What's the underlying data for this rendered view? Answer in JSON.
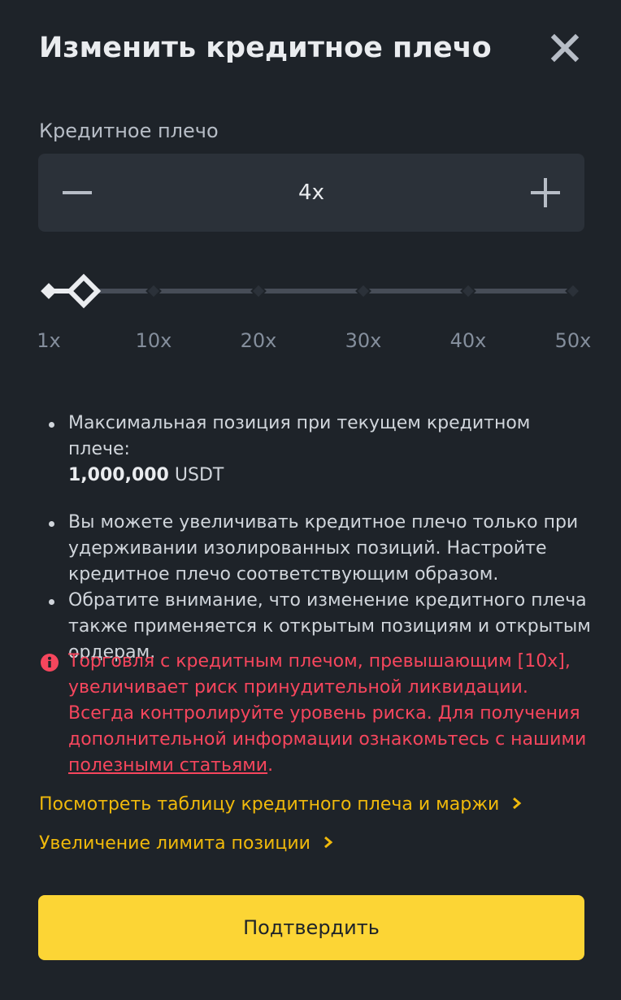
{
  "modal": {
    "title": "Изменить кредитное плечо",
    "close_icon": "close-icon"
  },
  "leverage": {
    "label": "Кредитное плечо",
    "value": "4x",
    "numeric_value": 4,
    "min": 1,
    "max": 50,
    "minus_icon": "minus-icon",
    "plus_icon": "plus-icon"
  },
  "slider": {
    "ticks": [
      "1x",
      "10x",
      "20x",
      "30x",
      "40x",
      "50x"
    ],
    "tick_values": [
      1,
      10,
      20,
      30,
      40,
      50
    ]
  },
  "info": {
    "max_position_text": "Максимальная позиция при текущем кредитном плече:",
    "max_position_value": "1,000,000",
    "max_position_unit": "USDT",
    "isolated_note": "Вы можете увеличивать кредитное плечо только при удерживании изолированных позиций. Настройте кредитное плечо соответствующим образом.",
    "open_orders_note": "Обратите внимание, что изменение кредитного плеча также применяется к открытым позициям и открытым ордерам."
  },
  "warning": {
    "icon": "info-circle-icon",
    "text": "Торговля с кредитным плечом, превышающим [10x], увеличивает риск принудительной ликвидации. Всегда контролируйте уровень риска. Для получения дополнительной информации ознакомьтесь с нашими ",
    "link_text": "полезными статьями",
    "end": "."
  },
  "links": {
    "margin_table": "Посмотреть таблицу кредитного плеча и маржи",
    "position_limit": "Увеличение лимита позиции",
    "chevron_icon": "chevron-right-icon"
  },
  "confirm": {
    "label": "Подтвердить"
  },
  "colors": {
    "background": "#1e2329",
    "input_bg": "#2b3139",
    "accent": "#fcd535",
    "link": "#f0b90b",
    "danger": "#f6465d"
  }
}
